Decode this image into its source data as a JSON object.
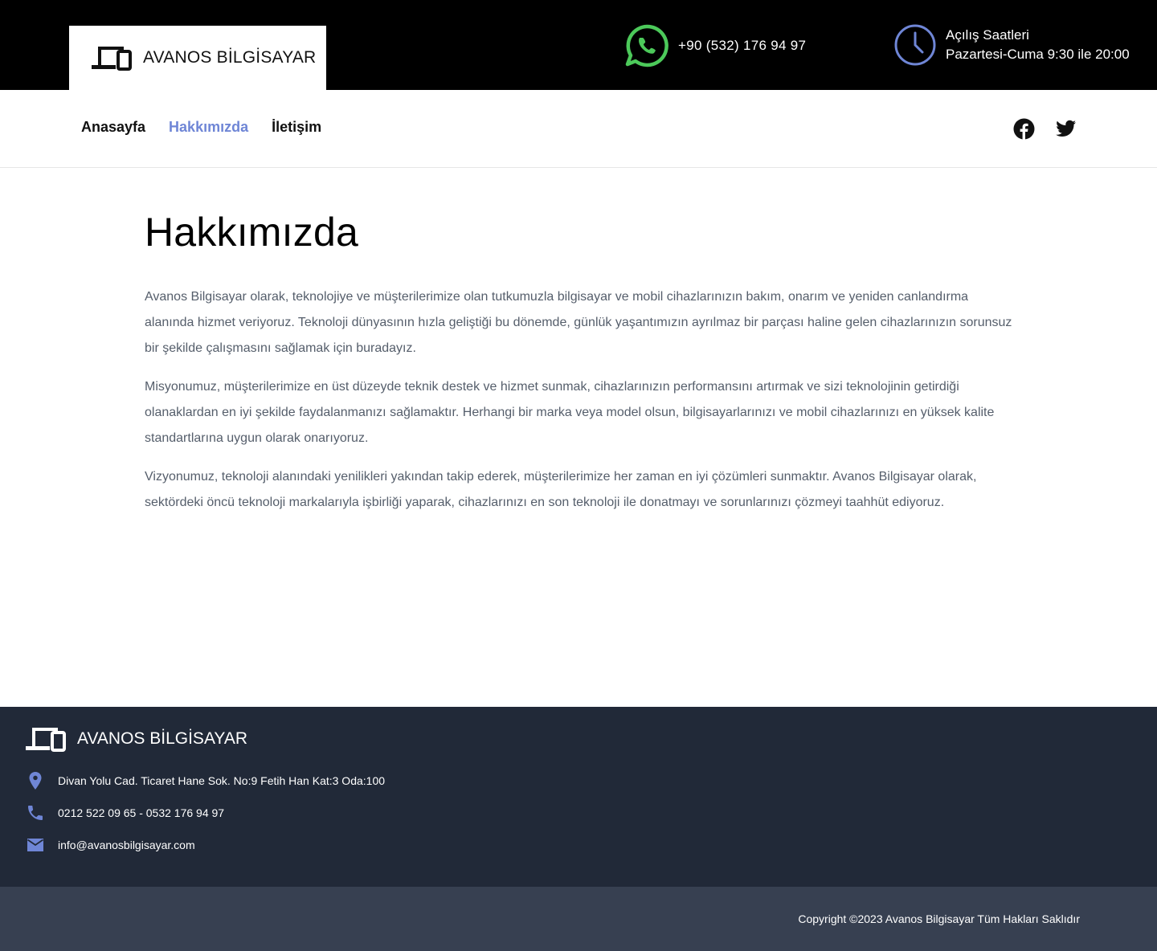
{
  "header": {
    "brand": "AVANOS BİLGİSAYAR",
    "phone": "+90 (532) 176 94 97",
    "hours_title": "Açılış Saatleri",
    "hours_value": "Pazartesi-Cuma 9:30 ile 20:00",
    "icons": [
      "devices-icon",
      "whatsapp-icon",
      "clock-icon"
    ],
    "colors": {
      "whatsapp": "#4cc95a",
      "clock": "#6f86d6"
    }
  },
  "nav": {
    "items": [
      {
        "label": "Anasayfa",
        "active": false
      },
      {
        "label": "Hakkımızda",
        "active": true
      },
      {
        "label": "İletişim",
        "active": false
      }
    ],
    "social": [
      "facebook-icon",
      "twitter-icon"
    ],
    "active_color": "#6f86d6"
  },
  "main": {
    "title": "Hakkımızda",
    "paragraphs": [
      "Avanos Bilgisayar olarak, teknolojiye ve müşterilerimize olan tutkumuzla bilgisayar ve mobil cihazlarınızın bakım, onarım ve yeniden canlandırma alanında hizmet veriyoruz. Teknoloji dünyasının hızla geliştiği bu dönemde, günlük yaşantımızın ayrılmaz bir parçası haline gelen cihazlarınızın sorunsuz bir şekilde çalışmasını sağlamak için buradayız.",
      "Misyonumuz, müşterilerimize en üst düzeyde teknik destek ve hizmet sunmak, cihazlarınızın performansını artırmak ve sizi teknolojinin getirdiği olanaklardan en iyi şekilde faydalanmanızı sağlamaktır. Herhangi bir marka veya model olsun, bilgisayarlarınızı ve mobil cihazlarınızı en yüksek kalite standartlarına uygun olarak onarıyoruz.",
      "Vizyonumuz, teknoloji alanındaki yenilikleri yakından takip ederek, müşterilerimize her zaman en iyi çözümleri sunmaktır. Avanos Bilgisayar olarak, sektördeki öncü teknoloji markalarıyla işbirliği yaparak, cihazlarınızı en son teknoloji ile donatmayı ve sorunlarınızı çözmeyi taahhüt ediyoruz."
    ]
  },
  "footer": {
    "brand": "AVANOS BİLGİSAYAR",
    "address": "Divan Yolu Cad. Ticaret Hane Sok. No:9 Fetih Han Kat:3 Oda:100",
    "phones": "0212 522 09 65 - 0532 176 94 97",
    "email": "info@avanosbilgisayar.com",
    "icons": [
      "map-pin-icon",
      "phone-icon",
      "mail-icon"
    ],
    "icon_color": "#6f86d6",
    "copyright": "Copyright ©2023 Avanos Bilgisayar Tüm Hakları Saklıdır"
  }
}
